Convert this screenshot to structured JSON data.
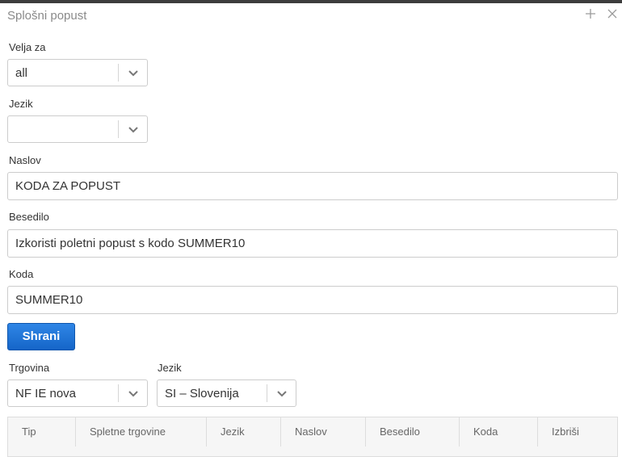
{
  "dialog": {
    "title": "Splošni popust",
    "expand_icon": "plus-icon",
    "close_icon": "close-icon"
  },
  "form": {
    "applies_to": {
      "label": "Velja za",
      "value": "all"
    },
    "language": {
      "label": "Jezik",
      "value": ""
    },
    "heading": {
      "label": "Naslov",
      "value": "KODA ZA POPUST"
    },
    "text": {
      "label": "Besedilo",
      "value": "Izkoristi poletni popust s kodo SUMMER10"
    },
    "code": {
      "label": "Koda",
      "value": "SUMMER10"
    },
    "save_label": "Shrani"
  },
  "filters": {
    "store": {
      "label": "Trgovina",
      "value": "NF IE nova"
    },
    "language": {
      "label": "Jezik",
      "value": "SI – Slovenija"
    }
  },
  "table": {
    "columns": [
      "Tip",
      "Spletne trgovine",
      "Jezik",
      "Naslov",
      "Besedilo",
      "Koda",
      "Izbriši"
    ]
  },
  "colors": {
    "accent": "#1a6fd4",
    "border": "#cccccc",
    "title_text": "#8a8a8a"
  }
}
